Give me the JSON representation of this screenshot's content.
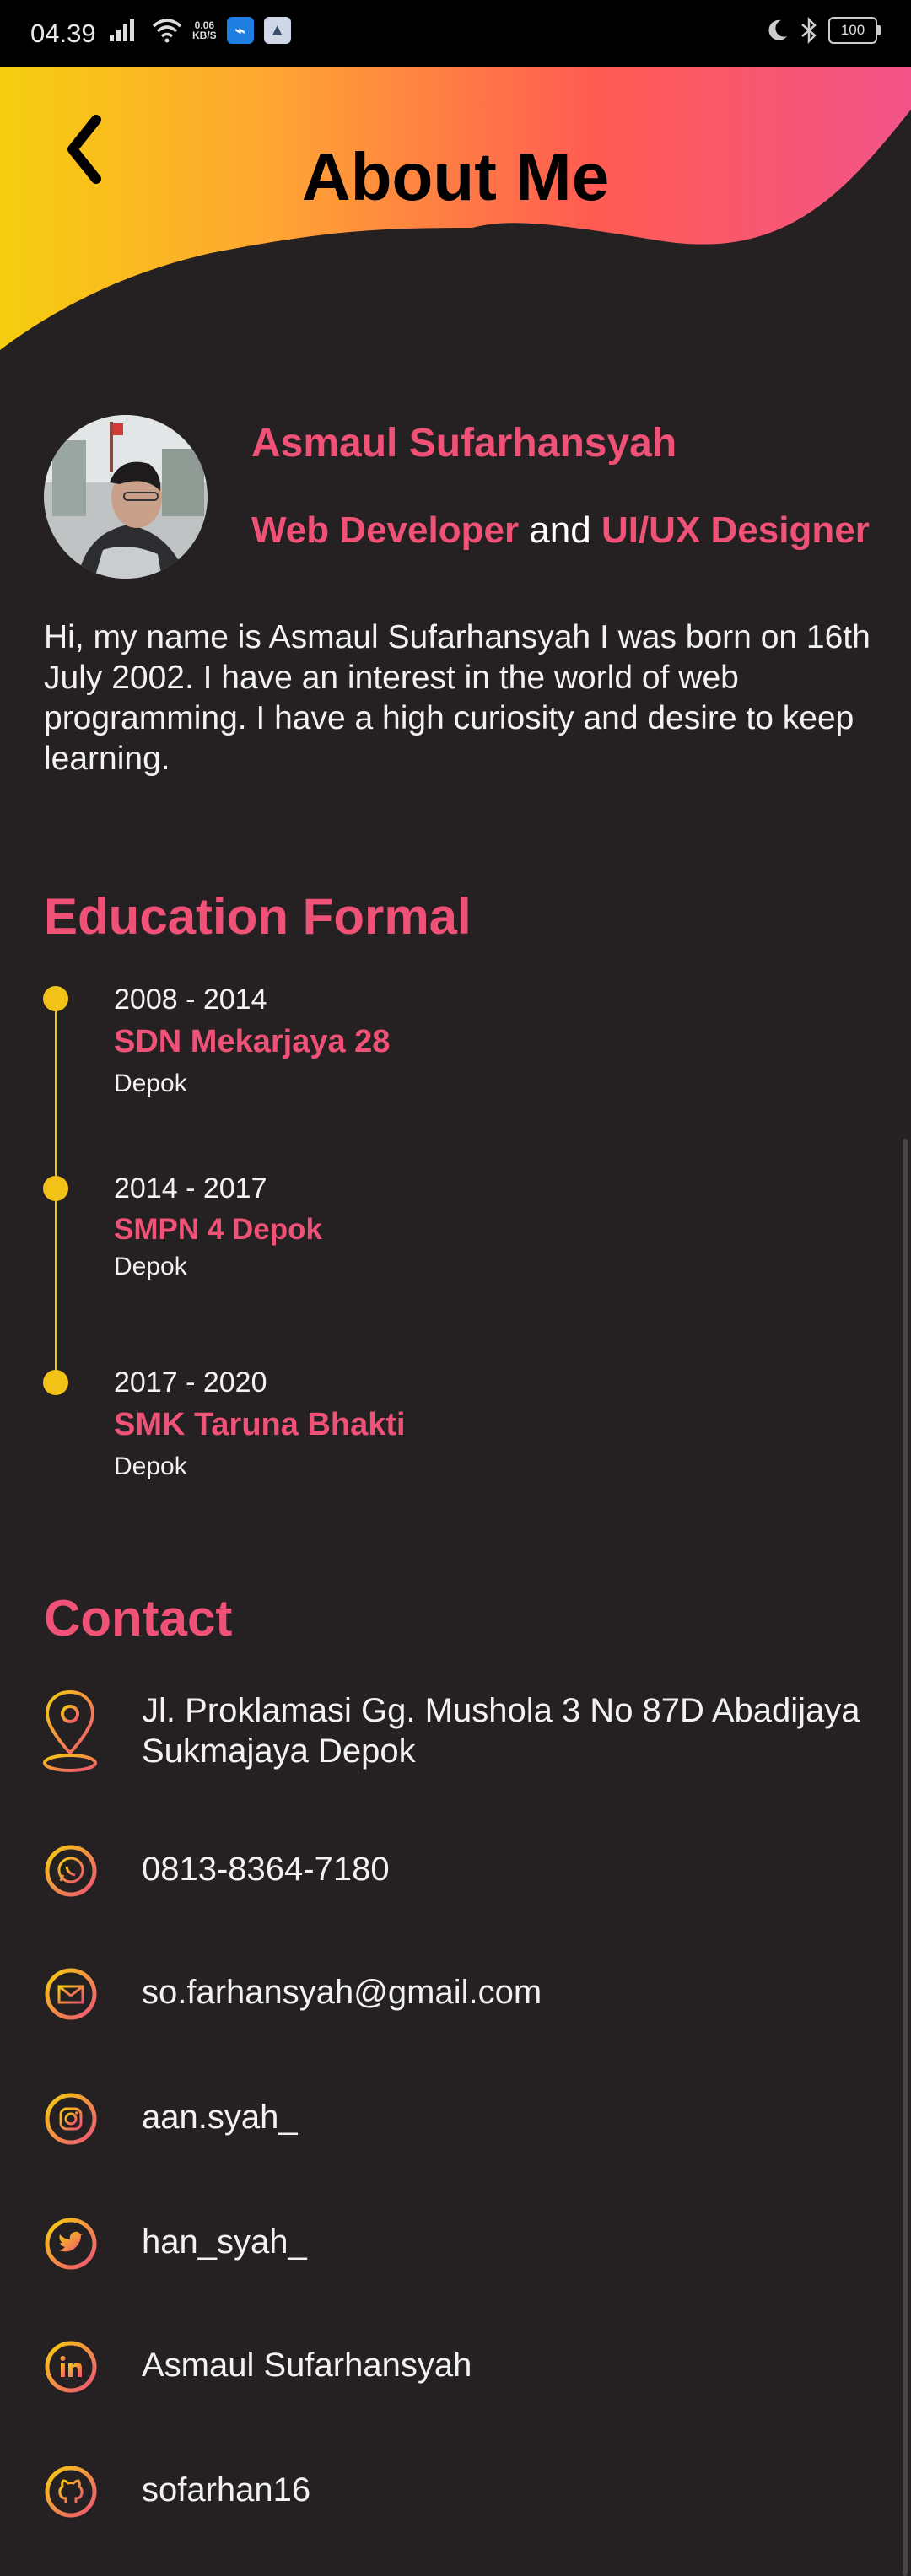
{
  "status_bar": {
    "time": "04.39",
    "net_speed_value": "0.06",
    "net_speed_unit": "KB/S",
    "battery": "100"
  },
  "header": {
    "title": "About Me",
    "gradient": [
      "#f6ce0f",
      "#ffa533",
      "#ff5c52",
      "#f2548a"
    ]
  },
  "profile": {
    "name": "Asmaul Sufarhansyah",
    "role_part1": "Web Developer",
    "role_conj": " and ",
    "role_part2": "UI/UX Designer",
    "bio": "Hi, my name is Asmaul Sufarhansyah I was born on 16th July  2002. I have an interest in the world of web programming. I have a high curiosity and desire to keep learning."
  },
  "education": {
    "title": "Education Formal",
    "items": [
      {
        "years": "2008 - 2014",
        "school": "SDN Mekarjaya 28",
        "city": "Depok"
      },
      {
        "years": "2014 - 2017",
        "school": "SMPN 4 Depok",
        "city": "Depok"
      },
      {
        "years": "2017 - 2020",
        "school": "SMK Taruna Bhakti",
        "city": "Depok"
      }
    ]
  },
  "contact": {
    "title": "Contact",
    "address": "Jl. Proklamasi Gg. Mushola 3 No 87D Abadijaya Sukmajaya Depok",
    "whatsapp": "0813-8364-7180",
    "email": "so.farhansyah@gmail.com",
    "instagram": "aan.syah_",
    "twitter": "han_syah_",
    "linkedin": "Asmaul Sufarhansyah",
    "github": "sofarhan16"
  },
  "colors": {
    "accent_pink": "#ef5177",
    "accent_yellow": "#f2c316",
    "background": "#252021"
  }
}
